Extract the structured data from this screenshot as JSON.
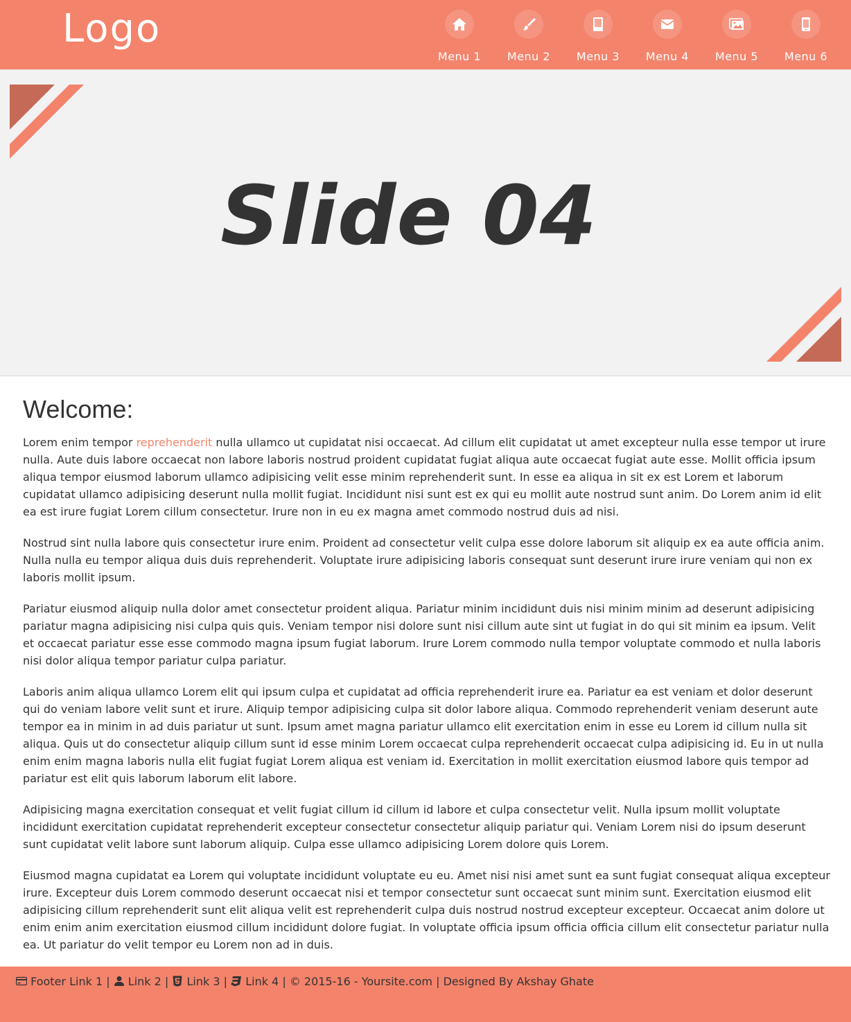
{
  "header": {
    "logo": "Logo",
    "menu": [
      {
        "label": "Menu 1",
        "icon": "home-icon"
      },
      {
        "label": "Menu 2",
        "icon": "brush-icon"
      },
      {
        "label": "Menu 3",
        "icon": "book-icon"
      },
      {
        "label": "Menu 4",
        "icon": "mail-icon"
      },
      {
        "label": "Menu 5",
        "icon": "image-icon"
      },
      {
        "label": "Menu 6",
        "icon": "mobile-icon"
      }
    ]
  },
  "slider": {
    "title": "Slide 04"
  },
  "main": {
    "heading": "Welcome:",
    "p1_before": "Lorem enim tempor ",
    "p1_link": "reprehenderit",
    "p1_after": " nulla ullamco ut cupidatat nisi occaecat. Ad cillum elit cupidatat ut amet excepteur nulla esse tempor ut irure nulla. Aute duis labore occaecat non labore laboris nostrud proident cupidatat fugiat aliqua aute occaecat fugiat aute esse. Mollit officia ipsum aliqua tempor eiusmod laborum ullamco adipisicing velit esse minim reprehenderit sunt. In esse ea aliqua in sit ex est Lorem et laborum cupidatat ullamco adipisicing deserunt nulla mollit fugiat. Incididunt nisi sunt est ex qui eu mollit aute nostrud sunt anim. Do Lorem anim id elit ea est irure fugiat Lorem cillum consectetur. Irure non in eu ex magna amet commodo nostrud duis ad nisi.",
    "paragraphs": [
      "Nostrud sint nulla labore quis consectetur irure enim. Proident ad consectetur velit culpa esse dolore laborum sit aliquip ex ea aute officia anim. Nulla nulla eu tempor aliqua duis duis reprehenderit. Voluptate irure adipisicing laboris consequat sunt deserunt irure irure veniam qui non ex laboris mollit ipsum.",
      "Pariatur eiusmod aliquip nulla dolor amet consectetur proident aliqua. Pariatur minim incididunt duis nisi minim minim ad deserunt adipisicing pariatur magna adipisicing nisi culpa quis quis. Veniam tempor nisi dolore sunt nisi cillum aute sint ut fugiat in do qui sit minim ea ipsum. Velit et occaecat pariatur esse esse commodo magna ipsum fugiat laborum. Irure Lorem commodo nulla tempor voluptate commodo et nulla laboris nisi dolor aliqua tempor pariatur culpa pariatur.",
      "Laboris anim aliqua ullamco Lorem elit qui ipsum culpa et cupidatat ad officia reprehenderit irure ea. Pariatur ea est veniam et dolor deserunt qui do veniam labore velit sunt et irure. Aliquip tempor adipisicing culpa sit dolor labore aliqua. Commodo reprehenderit veniam deserunt aute tempor ea in minim in ad duis pariatur ut sunt. Ipsum amet magna pariatur ullamco elit exercitation enim in esse eu Lorem id cillum nulla sit aliqua. Quis ut do consectetur aliquip cillum sunt id esse minim Lorem occaecat culpa reprehenderit occaecat culpa adipisicing id. Eu in ut nulla enim enim magna laboris nulla elit fugiat fugiat Lorem aliqua est veniam id. Exercitation in mollit exercitation eiusmod labore quis tempor ad pariatur est elit quis laborum laborum elit labore.",
      "Adipisicing magna exercitation consequat et velit fugiat cillum id cillum id labore et culpa consectetur velit. Nulla ipsum mollit voluptate incididunt exercitation cupidatat reprehenderit excepteur consectetur consectetur aliquip pariatur qui. Veniam Lorem nisi do ipsum deserunt sunt cupidatat velit labore sunt laborum aliquip. Culpa esse ullamco adipisicing Lorem dolore quis Lorem.",
      "Eiusmod magna cupidatat ea Lorem qui voluptate incididunt voluptate eu eu. Amet nisi nisi amet sunt ea sunt fugiat consequat aliqua excepteur irure. Excepteur duis Lorem commodo deserunt occaecat nisi et tempor consectetur sunt occaecat sunt minim sunt. Exercitation eiusmod elit adipisicing cillum reprehenderit sunt elit aliqua velit est reprehenderit culpa duis nostrud nostrud excepteur excepteur. Occaecat anim dolore ut enim enim anim exercitation eiusmod cillum incididunt dolore fugiat. In voluptate officia ipsum officia officia cillum elit consectetur pariatur nulla ea. Ut pariatur do velit tempor eu Lorem non ad in duis."
    ]
  },
  "footer": {
    "link1": "Footer Link 1",
    "link2": "Link 2",
    "link3": "Link 3",
    "link4": "Link 4",
    "sep": "|",
    "copyright": "© 2015-16 - Yoursite.com",
    "credit": "Designed By Akshay Ghate",
    "icons": [
      "card-icon",
      "user-icon",
      "html5-icon",
      "css3-icon"
    ]
  },
  "colors": {
    "brand": "#f4836b",
    "brand_dark": "#c56a56",
    "slider_bg": "#f2f2f2",
    "text": "#333333"
  }
}
